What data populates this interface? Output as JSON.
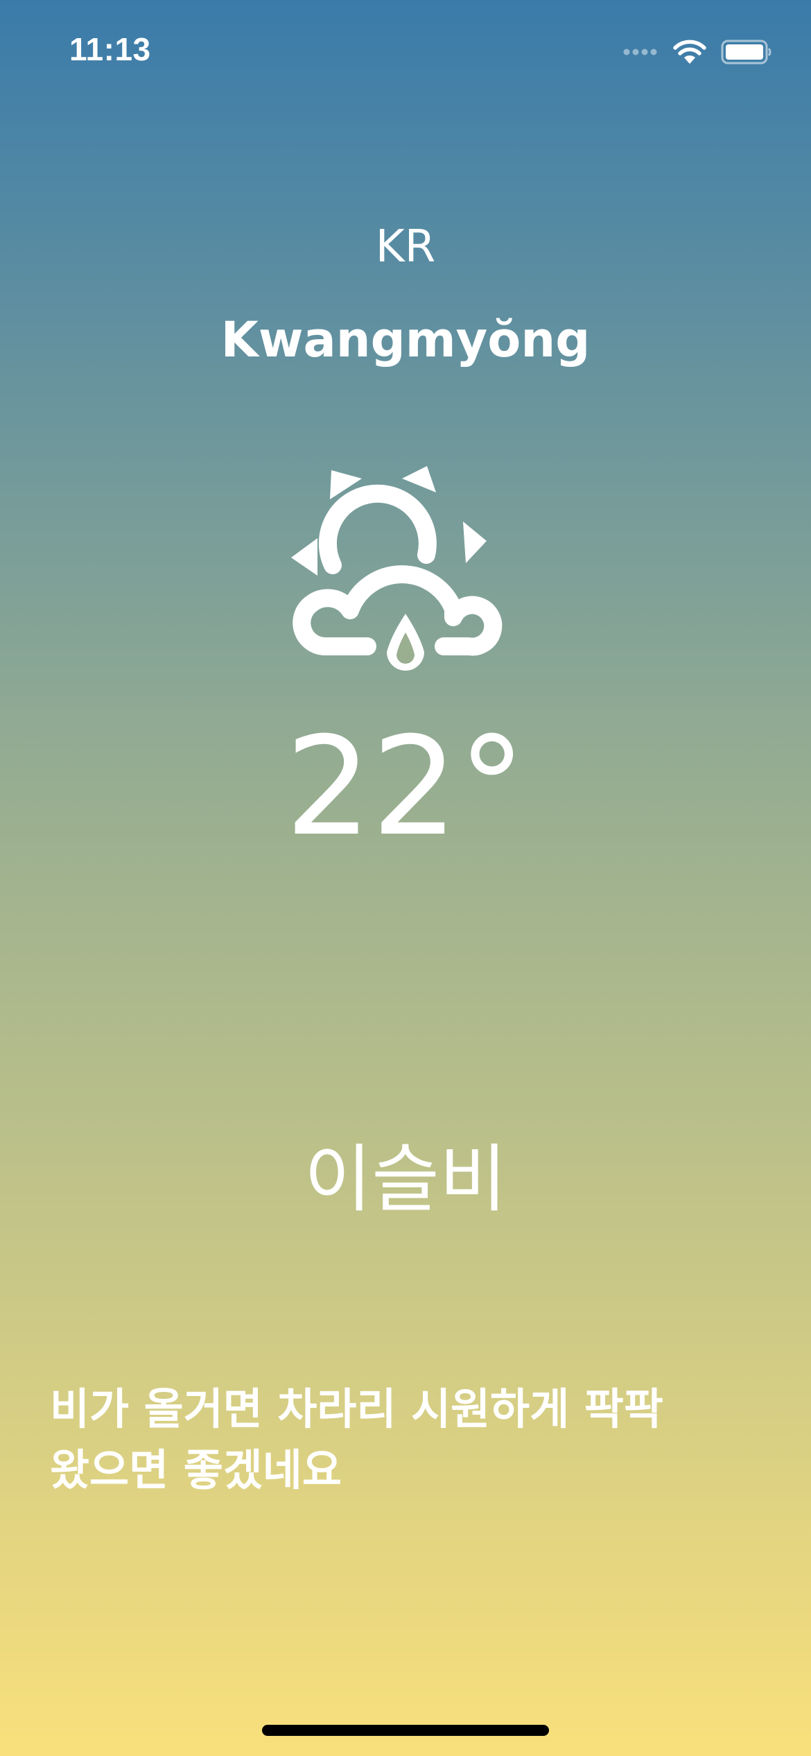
{
  "status_bar": {
    "time": "11:13",
    "icons": [
      "signal-dots-icon",
      "wifi-icon",
      "battery-icon"
    ]
  },
  "location": {
    "country": "KR",
    "city": "Kwangmyŏng"
  },
  "weather": {
    "icon": "partly-cloudy-rain-icon",
    "temperature": "22°",
    "condition": "이슬비",
    "message": "비가 올거면 차라리 시원하게 팍팍 왔으면 좋겠네요"
  },
  "colors": {
    "gradient_top": "#3A7BAA",
    "gradient_middle": "#98AE91",
    "gradient_bottom": "#F9E07C",
    "text": "#FFFFFF",
    "home_indicator": "#000000"
  }
}
